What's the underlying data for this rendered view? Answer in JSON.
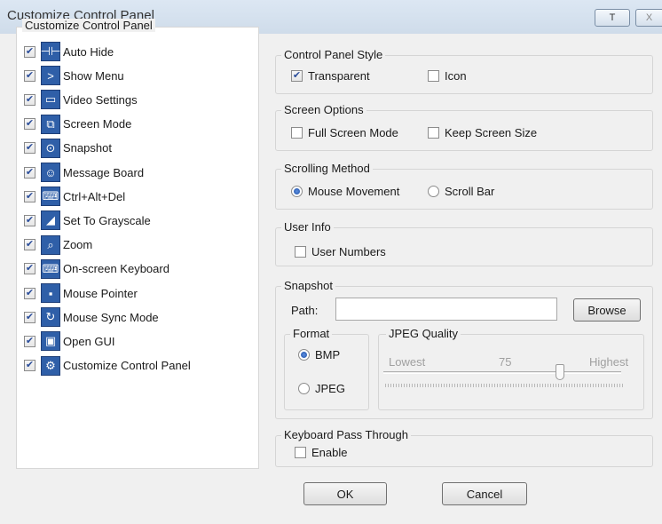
{
  "window": {
    "title": "Customize Control Panel",
    "pin_label": "T",
    "close_label": "X"
  },
  "panel_list": {
    "title": "Customize Control Panel",
    "items": [
      {
        "label": "Auto Hide",
        "checked": true,
        "icon": "auto-hide-icon",
        "glyph": "⊣⊢"
      },
      {
        "label": "Show Menu",
        "checked": true,
        "icon": "show-menu-icon",
        "glyph": ">"
      },
      {
        "label": "Video Settings",
        "checked": true,
        "icon": "video-settings-icon",
        "glyph": "▭"
      },
      {
        "label": "Screen Mode",
        "checked": true,
        "icon": "screen-mode-icon",
        "glyph": "⧉"
      },
      {
        "label": "Snapshot",
        "checked": true,
        "icon": "snapshot-icon",
        "glyph": "⊙"
      },
      {
        "label": "Message Board",
        "checked": true,
        "icon": "message-board-icon",
        "glyph": "☺"
      },
      {
        "label": "Ctrl+Alt+Del",
        "checked": true,
        "icon": "ctrl-alt-del-icon",
        "glyph": "⌨"
      },
      {
        "label": "Set To Grayscale",
        "checked": true,
        "icon": "grayscale-icon",
        "glyph": "◢"
      },
      {
        "label": "Zoom",
        "checked": true,
        "icon": "zoom-icon",
        "glyph": "⌕"
      },
      {
        "label": "On-screen Keyboard",
        "checked": true,
        "icon": "onscreen-keyboard-icon",
        "glyph": "⌨"
      },
      {
        "label": "Mouse Pointer",
        "checked": true,
        "icon": "mouse-pointer-icon",
        "glyph": "▪"
      },
      {
        "label": "Mouse Sync Mode",
        "checked": true,
        "icon": "mouse-sync-icon",
        "glyph": "↻"
      },
      {
        "label": "Open GUI",
        "checked": true,
        "icon": "open-gui-icon",
        "glyph": "▣"
      },
      {
        "label": "Customize Control Panel",
        "checked": true,
        "icon": "customize-icon",
        "glyph": "⚙"
      }
    ]
  },
  "control_panel_style": {
    "title": "Control Panel Style",
    "transparent": {
      "label": "Transparent",
      "checked": true
    },
    "icon": {
      "label": "Icon",
      "checked": false
    }
  },
  "screen_options": {
    "title": "Screen Options",
    "full_screen": {
      "label": "Full Screen Mode",
      "checked": false
    },
    "keep_size": {
      "label": "Keep Screen Size",
      "checked": false
    }
  },
  "scrolling_method": {
    "title": "Scrolling Method",
    "mouse_movement": {
      "label": "Mouse Movement",
      "selected": true
    },
    "scroll_bar": {
      "label": "Scroll Bar",
      "selected": false
    }
  },
  "user_info": {
    "title": "User Info",
    "user_numbers": {
      "label": "User Numbers",
      "checked": false
    }
  },
  "snapshot": {
    "title": "Snapshot",
    "path_label": "Path:",
    "path_value": "",
    "browse_label": "Browse",
    "format": {
      "title": "Format",
      "bmp": {
        "label": "BMP",
        "selected": true
      },
      "jpeg": {
        "label": "JPEG",
        "selected": false
      }
    },
    "jpeg_quality": {
      "title": "JPEG Quality",
      "lowest_label": "Lowest",
      "value": "75",
      "highest_label": "Highest",
      "min": 0,
      "max": 100,
      "level": 75
    }
  },
  "keyboard_pass_through": {
    "title": "Keyboard Pass Through",
    "enable": {
      "label": "Enable",
      "checked": false
    }
  },
  "buttons": {
    "ok_label": "OK",
    "cancel_label": "Cancel"
  },
  "colors": {
    "icon_blue": "#2f5fa8",
    "titlebar": "#dce7f3"
  }
}
